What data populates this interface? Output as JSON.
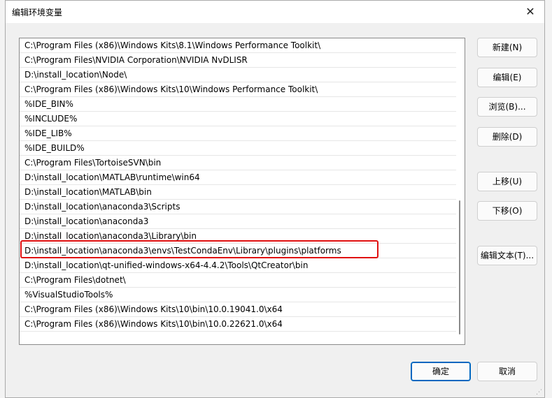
{
  "dialog": {
    "title": "编辑环境变量",
    "close_glyph": "✕"
  },
  "list": {
    "items": [
      "C:\\Program Files (x86)\\Windows Kits\\8.1\\Windows Performance Toolkit\\",
      "C:\\Program Files\\NVIDIA Corporation\\NVIDIA NvDLISR",
      "D:\\install_location\\Node\\",
      "C:\\Program Files (x86)\\Windows Kits\\10\\Windows Performance Toolkit\\",
      "%IDE_BIN%",
      "%INCLUDE%",
      "%IDE_LIB%",
      "%IDE_BUILD%",
      "C:\\Program Files\\TortoiseSVN\\bin",
      "D:\\install_location\\MATLAB\\runtime\\win64",
      "D:\\install_location\\MATLAB\\bin",
      "D:\\install_location\\anaconda3\\Scripts",
      "D:\\install_location\\anaconda3",
      "D:\\install_location\\anaconda3\\Library\\bin",
      "D:\\install_location\\anaconda3\\envs\\TestCondaEnv\\Library\\plugins\\platforms",
      "D:\\install_location\\qt-unified-windows-x64-4.4.2\\Tools\\QtCreator\\bin",
      "C:\\Program Files\\dotnet\\",
      "%VisualStudioTools%",
      "C:\\Program Files (x86)\\Windows Kits\\10\\bin\\10.0.19041.0\\x64",
      "C:\\Program Files (x86)\\Windows Kits\\10\\bin\\10.0.22621.0\\x64"
    ],
    "highlight_color": "#e01010"
  },
  "buttons": {
    "new": "新建(N)",
    "edit": "编辑(E)",
    "browse": "浏览(B)...",
    "delete": "删除(D)",
    "move_up": "上移(U)",
    "move_down": "下移(O)",
    "edit_text": "编辑文本(T)...",
    "ok": "确定",
    "cancel": "取消"
  },
  "accent_color": "#0067c0"
}
